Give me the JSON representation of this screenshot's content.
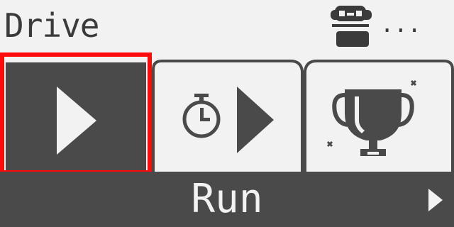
{
  "header": {
    "title": "Drive",
    "status_text": "...",
    "status_icon": "controller-icon"
  },
  "tabs": [
    {
      "id": "run",
      "icon": "play-icon",
      "selected": true
    },
    {
      "id": "timed",
      "icon": "stopwatch-play-icon",
      "selected": false
    },
    {
      "id": "trophy",
      "icon": "trophy-icon",
      "selected": false
    }
  ],
  "footer": {
    "mode_label": "Run",
    "next_icon": "chevron-right-icon"
  },
  "colors": {
    "background": "#f2f2f2",
    "dark": "#4a4a4a",
    "selection": "#ff0a0a"
  }
}
